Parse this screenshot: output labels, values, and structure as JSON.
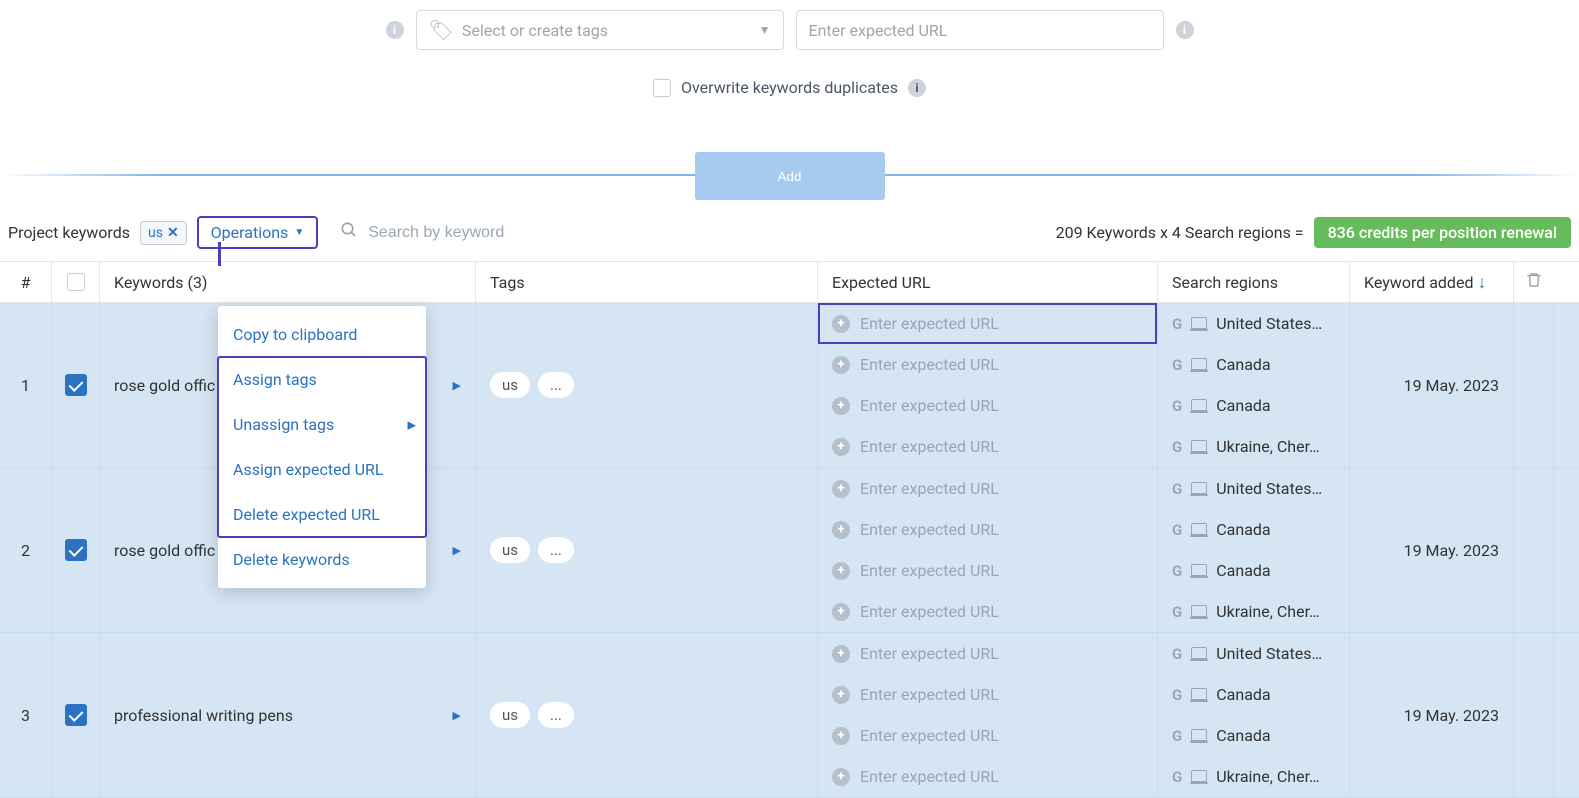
{
  "top": {
    "tags_placeholder": "Select or create tags",
    "url_placeholder": "Enter expected URL",
    "overwrite_label": "Overwrite keywords duplicates",
    "add_label": "Add"
  },
  "toolbar": {
    "project_keywords_label": "Project keywords",
    "filter_chip": "us",
    "operations_label": "Operations",
    "search_placeholder": "Search by keyword",
    "credits_prefix": "209 Keywords x 4 Search regions = ",
    "credits_badge": "836 credits per position renewal"
  },
  "dropdown": {
    "items": [
      "Copy to clipboard",
      "Assign tags",
      "Unassign tags",
      "Assign expected URL",
      "Delete expected URL",
      "Delete keywords"
    ]
  },
  "columns": {
    "num": "#",
    "keywords": "Keywords (3)",
    "tags": "Tags",
    "expected_url": "Expected URL",
    "search_regions": "Search regions",
    "keyword_added": "Keyword added"
  },
  "url_placeholder_row": "Enter expected URL",
  "regions": {
    "us": "United States…",
    "ca": "Canada",
    "uk": "Ukraine, Cher…"
  },
  "rows": [
    {
      "n": "1",
      "keyword": "rose gold offic",
      "tags": [
        "us",
        "..."
      ],
      "date": "19 May. 2023",
      "region_keys": [
        "us",
        "ca",
        "ca",
        "uk"
      ]
    },
    {
      "n": "2",
      "keyword": "rose gold offic",
      "tags": [
        "us",
        "..."
      ],
      "date": "19 May. 2023",
      "region_keys": [
        "us",
        "ca",
        "ca",
        "uk"
      ]
    },
    {
      "n": "3",
      "keyword": "professional writing pens",
      "tags": [
        "us",
        "..."
      ],
      "date": "19 May. 2023",
      "region_keys": [
        "us",
        "ca",
        "ca",
        "uk"
      ]
    }
  ]
}
